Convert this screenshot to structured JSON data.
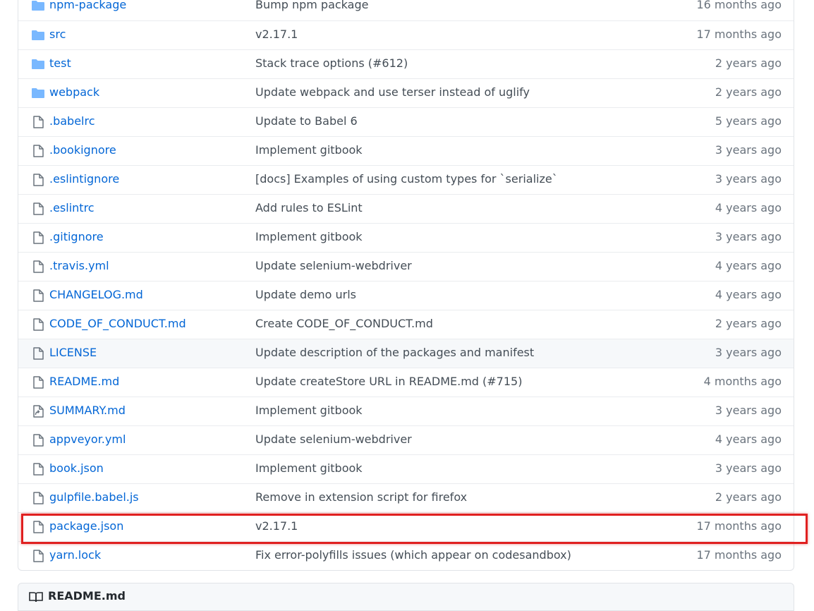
{
  "colors": {
    "link": "#0366d6",
    "folder_icon": "#79b8ff",
    "file_icon": "#6a737d",
    "highlight_border": "#e02020",
    "row_hover": "#f6f8fa"
  },
  "files": [
    {
      "name": "npm-package",
      "type": "folder",
      "icon": "folder-icon",
      "message": "Bump npm package",
      "age": "16 months ago"
    },
    {
      "name": "src",
      "type": "folder",
      "icon": "folder-icon",
      "message": "v2.17.1",
      "age": "17 months ago"
    },
    {
      "name": "test",
      "type": "folder",
      "icon": "folder-icon",
      "message": "Stack trace options (#612)",
      "age": "2 years ago"
    },
    {
      "name": "webpack",
      "type": "folder",
      "icon": "folder-icon",
      "message": "Update webpack and use terser instead of uglify",
      "age": "2 years ago"
    },
    {
      "name": ".babelrc",
      "type": "file",
      "icon": "file-icon",
      "message": "Update to Babel 6",
      "age": "5 years ago"
    },
    {
      "name": ".bookignore",
      "type": "file",
      "icon": "file-icon",
      "message": "Implement gitbook",
      "age": "3 years ago"
    },
    {
      "name": ".eslintignore",
      "type": "file",
      "icon": "file-icon",
      "message": "[docs] Examples of using custom types for `serialize`",
      "age": "3 years ago"
    },
    {
      "name": ".eslintrc",
      "type": "file",
      "icon": "file-icon",
      "message": "Add rules to ESLint",
      "age": "4 years ago"
    },
    {
      "name": ".gitignore",
      "type": "file",
      "icon": "file-icon",
      "message": "Implement gitbook",
      "age": "3 years ago"
    },
    {
      "name": ".travis.yml",
      "type": "file",
      "icon": "file-icon",
      "message": "Update selenium-webdriver",
      "age": "4 years ago"
    },
    {
      "name": "CHANGELOG.md",
      "type": "file",
      "icon": "file-icon",
      "message": "Update demo urls",
      "age": "4 years ago"
    },
    {
      "name": "CODE_OF_CONDUCT.md",
      "type": "file",
      "icon": "file-icon",
      "message": "Create CODE_OF_CONDUCT.md",
      "age": "2 years ago"
    },
    {
      "name": "LICENSE",
      "type": "file",
      "icon": "file-icon",
      "message": "Update description of the packages and manifest",
      "age": "3 years ago"
    },
    {
      "name": "README.md",
      "type": "file",
      "icon": "file-icon",
      "message": "Update createStore URL in README.md (#715)",
      "age": "4 months ago"
    },
    {
      "name": "SUMMARY.md",
      "type": "symlink",
      "icon": "symlink-file-icon",
      "message": "Implement gitbook",
      "age": "3 years ago"
    },
    {
      "name": "appveyor.yml",
      "type": "file",
      "icon": "file-icon",
      "message": "Update selenium-webdriver",
      "age": "4 years ago"
    },
    {
      "name": "book.json",
      "type": "file",
      "icon": "file-icon",
      "message": "Implement gitbook",
      "age": "3 years ago"
    },
    {
      "name": "gulpfile.babel.js",
      "type": "file",
      "icon": "file-icon",
      "message": "Remove in extension script for firefox",
      "age": "2 years ago"
    },
    {
      "name": "package.json",
      "type": "file",
      "icon": "file-icon",
      "message": "v2.17.1",
      "age": "17 months ago",
      "highlighted": true
    },
    {
      "name": "yarn.lock",
      "type": "file",
      "icon": "file-icon",
      "message": "Fix error-polyfills issues (which appear on codesandbox)",
      "age": "17 months ago"
    }
  ],
  "readme": {
    "title": "README.md",
    "icon": "book-icon"
  }
}
